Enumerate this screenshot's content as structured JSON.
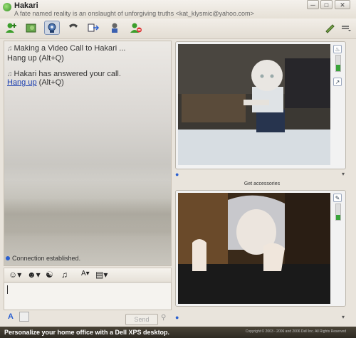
{
  "window": {
    "title": "Hakari",
    "subtitle": "A fate named reality is an onslaught of unforgiving truths <kat_klysmic@yahoo.com>"
  },
  "toolbar": {
    "buttons": [
      {
        "name": "add-contact",
        "icon": "user-plus-icon"
      },
      {
        "name": "share-photos",
        "icon": "photo-icon"
      },
      {
        "name": "video-call",
        "icon": "webcam-icon",
        "active": true
      },
      {
        "name": "voice-call",
        "icon": "phone-icon"
      },
      {
        "name": "send-file",
        "icon": "file-transfer-icon"
      },
      {
        "name": "invite-game",
        "icon": "game-icon"
      },
      {
        "name": "block-contact",
        "icon": "user-block-icon"
      }
    ]
  },
  "conversation": {
    "messages": [
      {
        "text": "Making a Video Call to Hakari ...",
        "action": "Hang up",
        "shortcut": "(Alt+Q)"
      },
      {
        "text": "Hakari has answered your call.",
        "action": "Hang up",
        "shortcut": "(Alt+Q)"
      }
    ],
    "status": "Connection established."
  },
  "video": {
    "accessories_label": "Get accessories"
  },
  "compose": {
    "send_label": "Send"
  },
  "footer": {
    "promo": "Personalize your home office with a Dell XPS desktop.",
    "copyright": "Copyright © 2003 - 2006 and 2006 Dell Inc. All Rights Reserved"
  },
  "colors": {
    "link": "#1a3fb0",
    "accent": "#2a5fd0"
  }
}
